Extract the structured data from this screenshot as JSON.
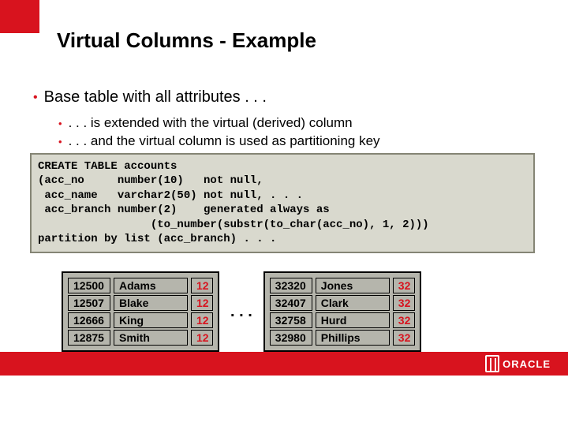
{
  "title": "Virtual Columns - Example",
  "bullets": {
    "main": "Base table with all attributes . . .",
    "sub1": ". . . is extended with the virtual (derived) column",
    "sub2": ". . . and the virtual column is used as partitioning key"
  },
  "code": "CREATE TABLE accounts\n(acc_no     number(10)   not null,\n acc_name   varchar2(50) not null, . . .\n acc_branch number(2)    generated always as\n                 (to_number(substr(to_char(acc_no), 1, 2)))\npartition by list (acc_branch) . . .",
  "partition1": {
    "acc": [
      "12500",
      "12507",
      "12666",
      "12875"
    ],
    "name": [
      "Adams",
      "Blake",
      "King",
      "Smith"
    ],
    "br": [
      "12",
      "12",
      "12",
      "12"
    ]
  },
  "ellipsis": ". . .",
  "partition2": {
    "acc": [
      "32320",
      "32407",
      "32758",
      "32980"
    ],
    "name": [
      "Jones",
      "Clark",
      "Hurd",
      "Phillips"
    ],
    "br": [
      "32",
      "32",
      "32",
      "32"
    ]
  },
  "logo_text": "ORACLE"
}
